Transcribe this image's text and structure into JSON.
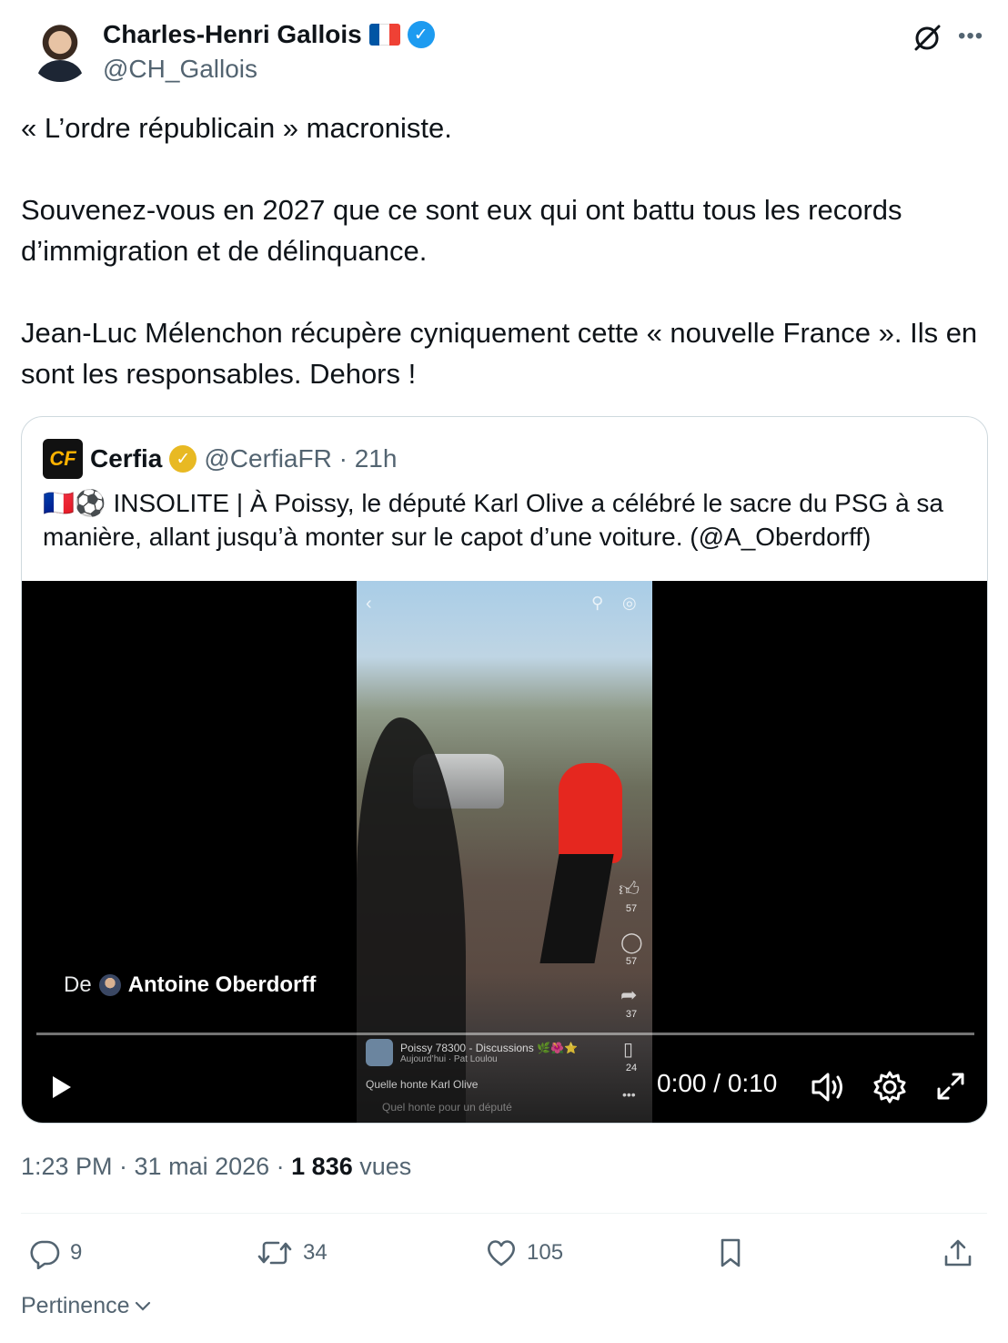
{
  "author": {
    "name": "Charles-Henri Gallois",
    "handle": "@CH_Gallois"
  },
  "tweet_text": "« L’ordre républicain » macroniste.\n\nSouvenez-vous en 2027 que ce sont eux qui ont battu tous les records d’immigration et de délinquance.\n\nJean-Luc Mélenchon récupère cyniquement cette « nouvelle France ». Ils en sont les responsables. Dehors !",
  "quote": {
    "logo_text": "CF",
    "name": "Cerfia",
    "meta": "@CerfiaFR · 21h",
    "text": "🇫🇷⚽ INSOLITE | À Poissy, le député Karl Olive a célébré le sacre du PSG à sa manière, allant jusqu’à monter sur le capot d’une voiture. (@A_Oberdorff)",
    "video": {
      "by_prefix": "De",
      "by_name": "Antoine Oberdorff",
      "time": "0:00 / 0:10",
      "progress": 0,
      "inner": {
        "likes": "57",
        "comments": "57",
        "shares": "37",
        "saves": "24",
        "group_name": "Poissy 78300 - Discussions 🌿🌺⭐",
        "group_sub": "Aujourd’hui · Pat Loulou",
        "caption": "Quelle honte Karl Olive",
        "comment": "Quel honte pour un député"
      }
    }
  },
  "timestamp": {
    "time_date": "1:23 PM · 31 mai 2026 · ",
    "views_count": "1 836",
    "views_label": " vues"
  },
  "actions": {
    "replies": "9",
    "retweets": "34",
    "likes": "105"
  },
  "sort_label": "Pertinence",
  "colors": {
    "verified_blue": "#1d9bf0",
    "gold_badge": "#e8b923",
    "secondary_text": "#536471"
  }
}
